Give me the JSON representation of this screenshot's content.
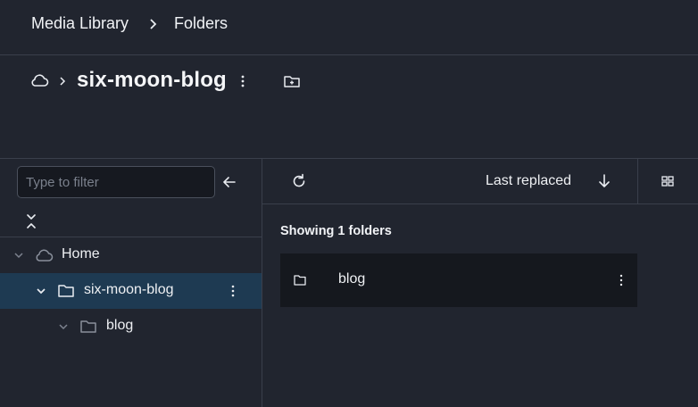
{
  "breadcrumb": {
    "root": "Media Library",
    "current": "Folders"
  },
  "folder_header": {
    "title": "six-moon-blog"
  },
  "sidebar": {
    "filter_placeholder": "Type to filter",
    "tree": [
      {
        "label": "Home",
        "icon": "cloud-icon",
        "expanded": true
      },
      {
        "label": "six-moon-blog",
        "icon": "folder-icon",
        "expanded": true,
        "selected": true
      },
      {
        "label": "blog",
        "icon": "folder-icon",
        "expanded": false
      }
    ]
  },
  "toolbar": {
    "sort_label": "Last replaced",
    "sort_direction": "descending"
  },
  "content": {
    "showing_text": "Showing 1 folders",
    "folders": [
      {
        "name": "blog",
        "icon": "folder-icon"
      }
    ]
  },
  "colors": {
    "background": "#21252f",
    "card": "#15181e",
    "selected_row": "#1e3a52",
    "divider": "#3a3f4b",
    "text": "#eef0f3"
  }
}
